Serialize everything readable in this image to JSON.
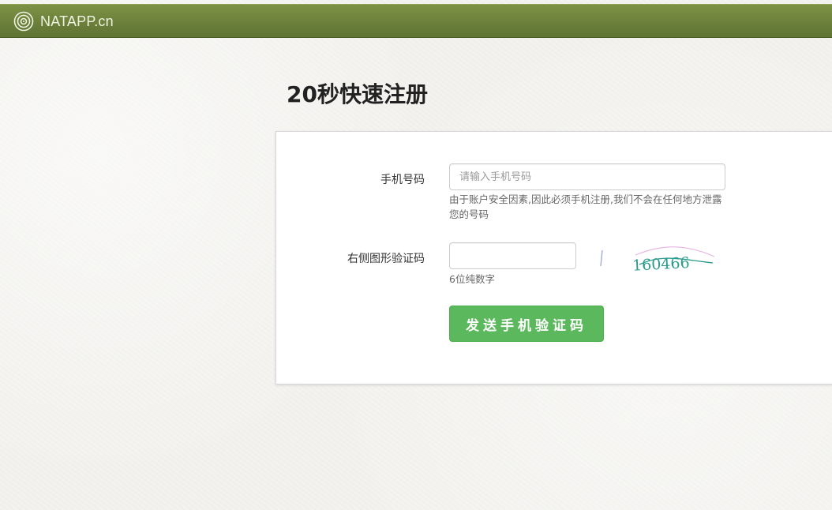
{
  "header": {
    "brand": "NATAPP.cn",
    "logo_icon": "spiral-logo-icon",
    "bar_color": "#6b7f3a"
  },
  "page": {
    "title": "20秒快速注册"
  },
  "form": {
    "phone": {
      "label": "手机号码",
      "placeholder": "请输入手机号码",
      "value": "",
      "help": "由于账户安全因素,因此必须手机注册,我们不会在任何地方泄露您的号码"
    },
    "captcha": {
      "label": "右侧图形验证码",
      "value": "",
      "help": "6位纯数字",
      "image_text": "160466"
    },
    "send_button": {
      "label": "发送手机验证码",
      "color": "#5cb85c"
    }
  }
}
